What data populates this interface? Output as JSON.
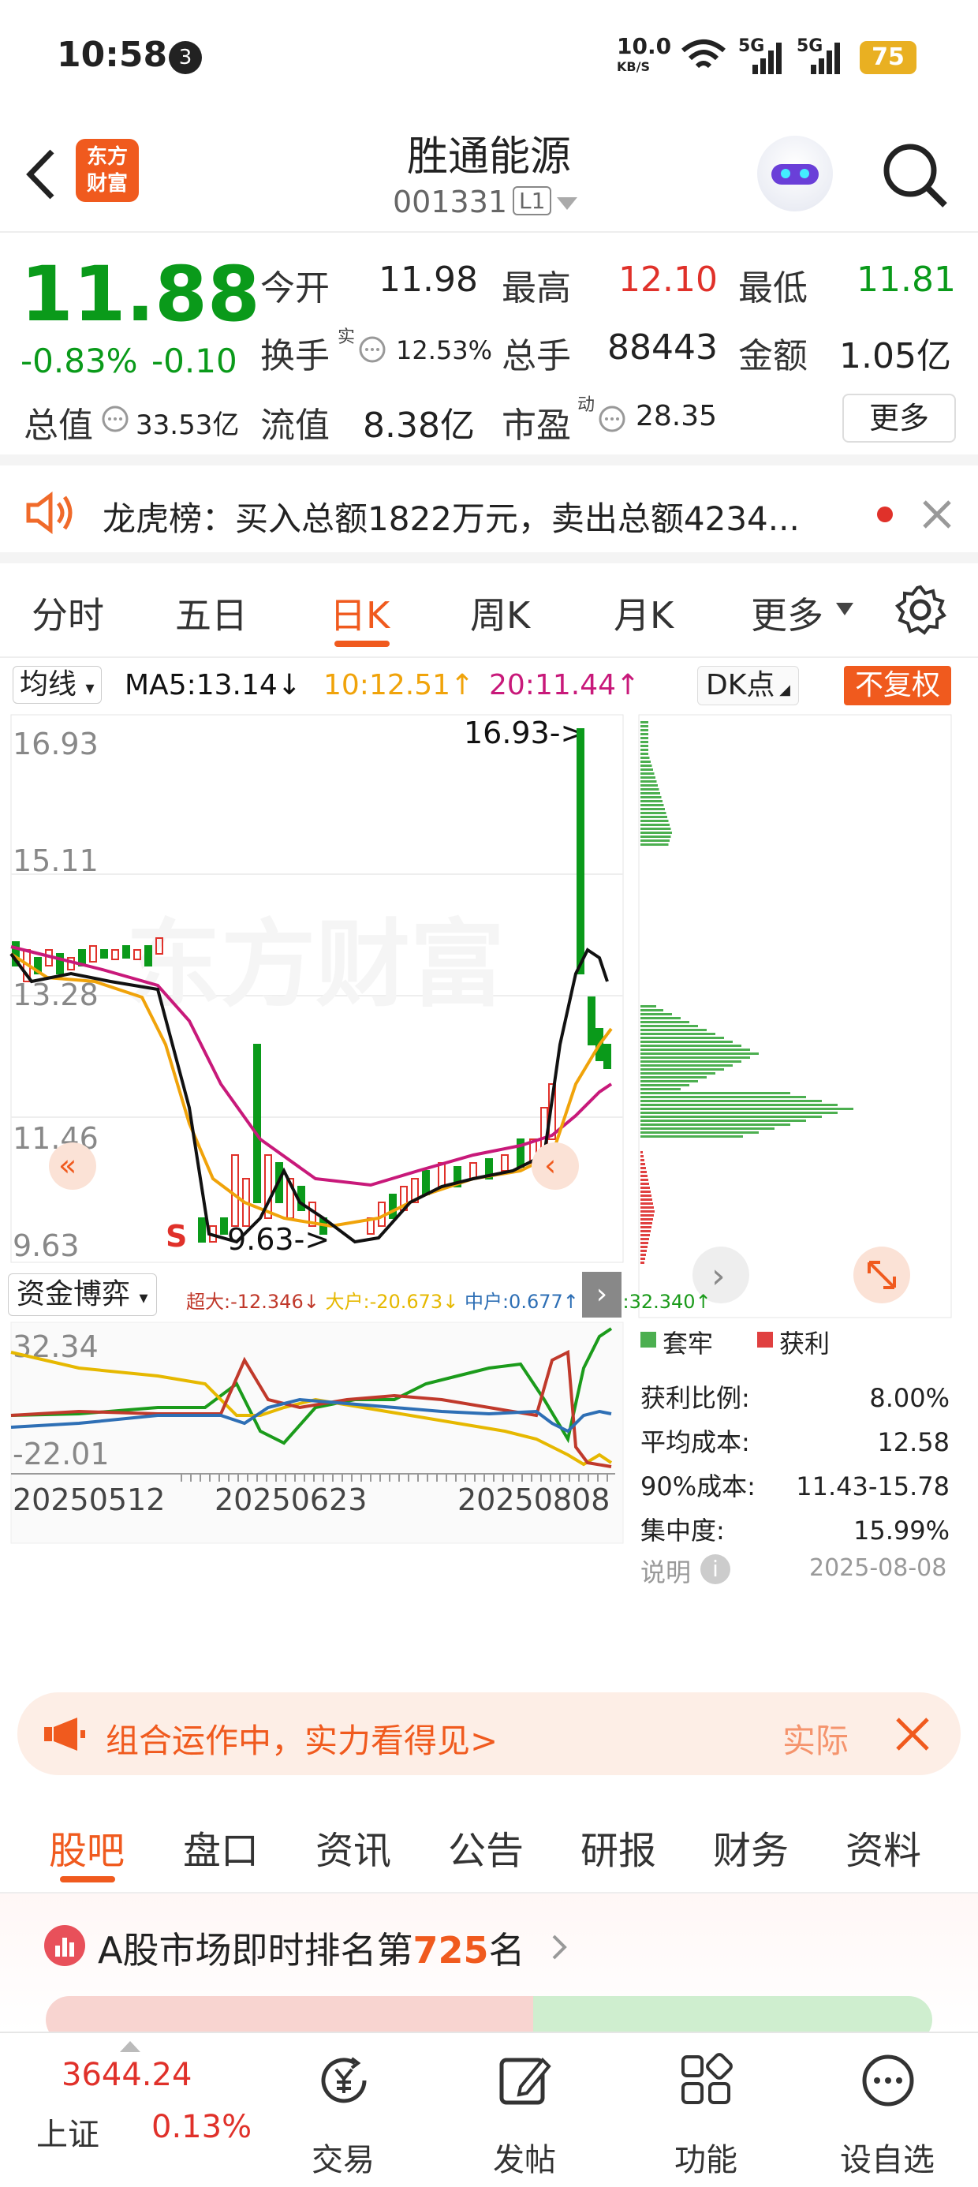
{
  "status": {
    "time": "10:58",
    "notif_count": "3",
    "net_speed_top": "10.0",
    "net_speed_bottom": "KB/S",
    "sig1": "5G",
    "sig2": "5G",
    "battery": "75"
  },
  "header": {
    "logo_line1": "东方",
    "logo_line2": "财富",
    "title": "胜通能源",
    "code": "001331",
    "level": "L1"
  },
  "quote": {
    "price": "11.88",
    "change_pct": "-0.83%",
    "change": "-0.10",
    "open_label": "今开",
    "open": "11.98",
    "high_label": "最高",
    "high": "12.10",
    "low_label": "最低",
    "low": "11.81",
    "turnover_label": "换手",
    "turnover_sup": "实",
    "turnover": "12.53%",
    "volume_label": "总手",
    "volume": "88443",
    "amount_label": "金额",
    "amount": "1.05亿",
    "mcap_label": "总值",
    "mcap": "33.53亿",
    "float_label": "流值",
    "float": "8.38亿",
    "pe_label": "市盈",
    "pe_sup": "动",
    "pe": "28.35",
    "more": "更多"
  },
  "notice": {
    "text": "龙虎榜：买入总额1822万元，卖出总额4234..."
  },
  "tabs": [
    "分时",
    "五日",
    "日K",
    "周K",
    "月K",
    "更多"
  ],
  "active_tab": 2,
  "chart": {
    "indicator": "均线",
    "ma5": "MA5:13.14↓",
    "ma10": "10:12.51↑",
    "ma20": "20:11.44↑",
    "dk": "DK点",
    "fq": "不复权",
    "high_mark": "16.93->",
    "low_mark": "9.63->",
    "s_mark": "S",
    "sub_indicator": "资金博弈",
    "sub_legend": [
      {
        "text": "超大:-12.346↓",
        "color": "#c0392b"
      },
      {
        "text": "大户:-20.673↓",
        "color": "#e6b800"
      },
      {
        "text": "中户:0.677↑",
        "color": "#2e6fb5"
      },
      {
        "text": "小户:32.340↑",
        "color": "#1b9b1b"
      }
    ],
    "dates": [
      "20250512",
      "20250623",
      "20250808"
    ],
    "watermark": "东方财富"
  },
  "chart_data": {
    "type": "candlestick",
    "y_ticks": [
      "16.93",
      "15.11",
      "11.46",
      "9.63"
    ],
    "y_axis_mid": "13.28",
    "ylim": [
      9.63,
      16.93
    ],
    "sub_y_ticks": [
      "32.34",
      "-22.01"
    ],
    "sub_ylim": [
      -22.01,
      32.34
    ],
    "x_ticks": [
      "20250512",
      "20250623",
      "20250808"
    ],
    "series": [
      {
        "name": "MA5",
        "color": "#111111"
      },
      {
        "name": "MA10",
        "color": "#f0a30a"
      },
      {
        "name": "MA20",
        "color": "#c8197a"
      }
    ]
  },
  "chip": {
    "legend_trap": "套牢",
    "legend_profit": "获利",
    "rows": [
      {
        "label": "获利比例:",
        "value": "8.00%"
      },
      {
        "label": "平均成本:",
        "value": "12.58"
      },
      {
        "label": "90%成本:",
        "value": "11.43-15.78"
      },
      {
        "label": "集中度:",
        "value": "15.99%"
      }
    ],
    "note": "说明",
    "date": "2025-08-08"
  },
  "ad": {
    "text": "组合运作中，实力看得见>",
    "right": "实际"
  },
  "feature_tabs": [
    "股吧",
    "盘口",
    "资讯",
    "公告",
    "研报",
    "财务",
    "资料"
  ],
  "active_feature_tab": 0,
  "rank": {
    "prefix": "A股市场即时排名第",
    "num": "725",
    "suffix": "名"
  },
  "bottom": {
    "index_value": "3644.24",
    "index_name": "上证",
    "index_pct": "0.13%",
    "trade": "交易",
    "post": "发帖",
    "function": "功能",
    "watch": "设自选"
  }
}
